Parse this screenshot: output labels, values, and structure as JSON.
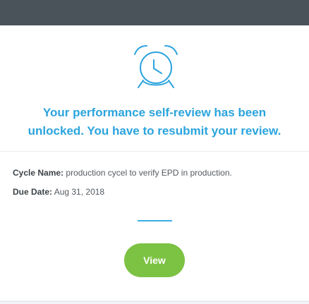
{
  "colors": {
    "topbar": "#4a525a",
    "accent_blue": "#2ba4de",
    "button_green": "#7cc243",
    "card_bg": "#ffffff"
  },
  "icon": "alarm-clock-icon",
  "headline": {
    "line1": "Your performance self-review has been",
    "line2": "unlocked. You have to resubmit your review."
  },
  "details": {
    "cycle_label": "Cycle Name:",
    "cycle_value": "production cycel to verify EPD in production.",
    "due_label": "Due Date:",
    "due_value": "Aug 31, 2018"
  },
  "button": {
    "label": "View"
  }
}
